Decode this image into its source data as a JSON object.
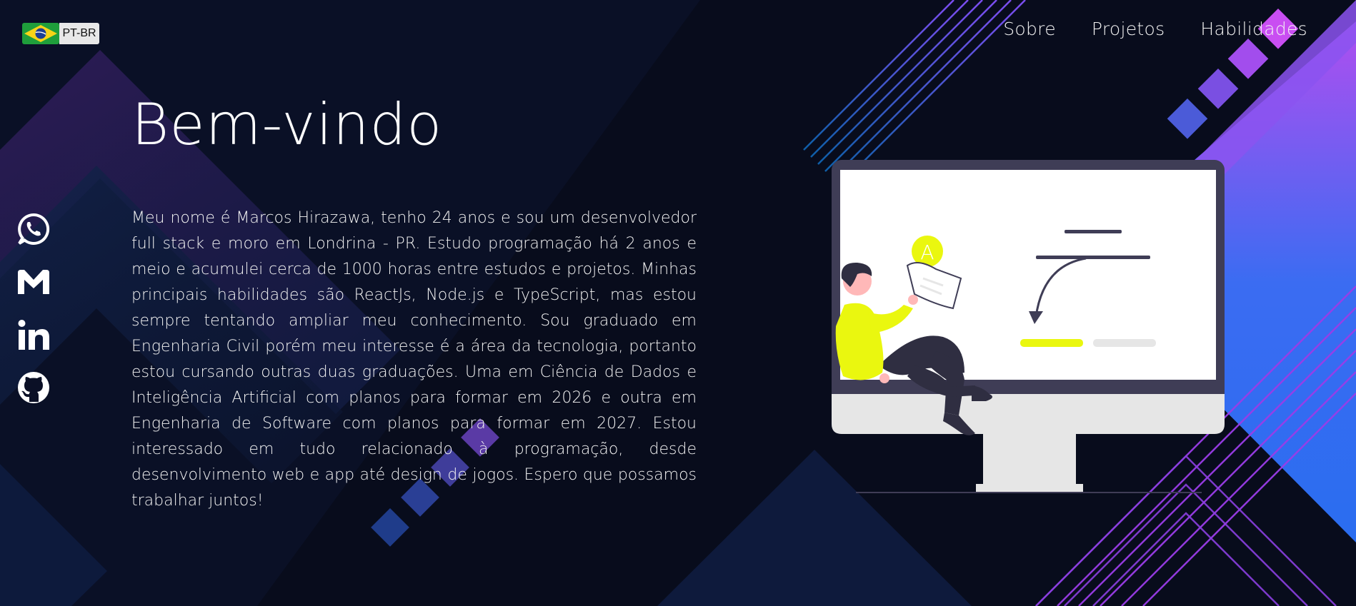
{
  "language_toggle": {
    "code": "PT-BR",
    "flag": "brazil-flag-icon"
  },
  "nav": {
    "items": [
      {
        "label": "Sobre"
      },
      {
        "label": "Projetos"
      },
      {
        "label": "Habilidades"
      }
    ]
  },
  "social": [
    {
      "name": "whatsapp-icon"
    },
    {
      "name": "gmail-icon"
    },
    {
      "name": "linkedin-icon"
    },
    {
      "name": "github-icon"
    }
  ],
  "hero": {
    "title": "Bem-vindo",
    "bio": "Meu nome é Marcos Hirazawa, tenho 24 anos e sou um desenvolvedor full stack e moro em Londrina - PR. Estudo programação há 2 anos e meio e acumulei cerca de 1000 horas entre estudos e projetos. Minhas principais habilidades são ReactJs, Node.js e TypeScript, mas estou sempre tentando ampliar meu conhecimento. Sou graduado em Engenharia Civil porém meu interesse é a área da tecnologia, portanto estou cursando outras duas graduações. Uma em Ciência de Dados e Inteligência Artificial com planos para formar em 2026 e outra em Engenharia de Software com planos para formar em 2027. Estou interessado em tudo relacionado à programação, desde desenvolvimento web e app até design de jogos. Espero que possamos trabalhar juntos!"
  },
  "illustration": {
    "badge_letter": "A",
    "accent": "#eaf70f"
  },
  "colors": {
    "background": "#080c1c",
    "purple": "#a855f7",
    "blue": "#2f6df2",
    "accent_yellow": "#eaf70f"
  }
}
